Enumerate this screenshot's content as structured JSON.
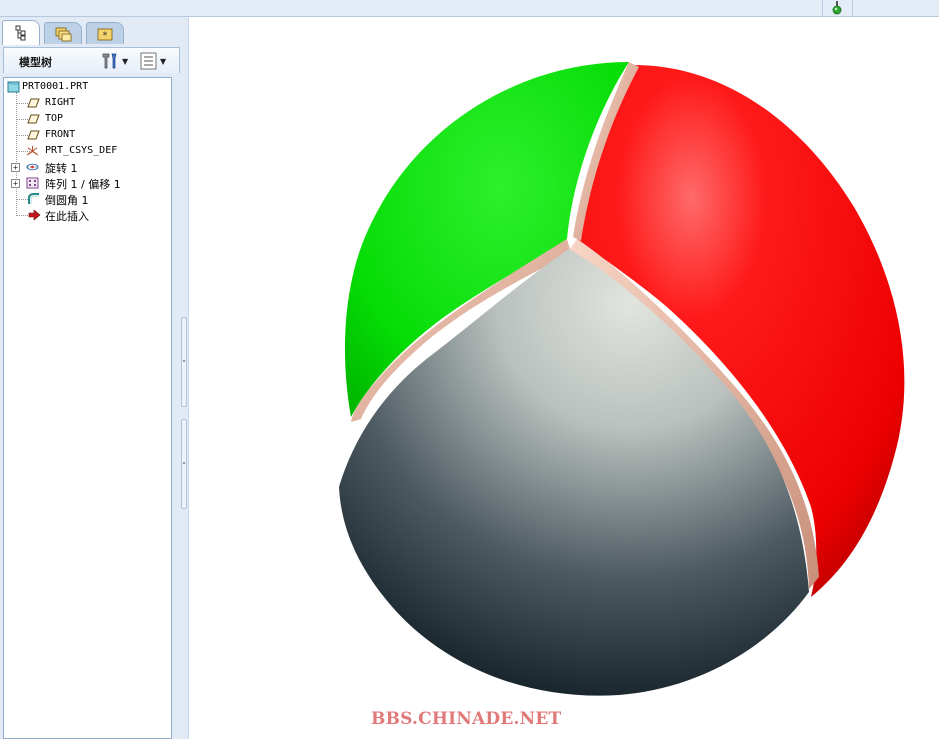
{
  "panel": {
    "tabs": [
      {
        "name": "model-tree-tab",
        "active": true
      },
      {
        "name": "folder-browser-tab",
        "active": false
      },
      {
        "name": "favorites-tab",
        "active": false
      }
    ],
    "title": "模型树"
  },
  "tree": {
    "root": "PRT0001.PRT",
    "items": [
      {
        "label": "RIGHT",
        "icon": "datum-plane-icon"
      },
      {
        "label": "TOP",
        "icon": "datum-plane-icon"
      },
      {
        "label": "FRONT",
        "icon": "datum-plane-icon"
      },
      {
        "label": "PRT_CSYS_DEF",
        "icon": "coordinate-system-icon"
      },
      {
        "label": "旋转 1",
        "icon": "revolve-icon",
        "expandable": true
      },
      {
        "label": "阵列 1 / 偏移 1",
        "icon": "pattern-icon",
        "expandable": true
      },
      {
        "label": "倒圆角 1",
        "icon": "round-icon"
      },
      {
        "label": "在此插入",
        "icon": "insert-here-arrow-icon"
      }
    ]
  },
  "viewport": {
    "watermark": "BBS.CHINADE.NET",
    "model_colors": {
      "green": "#00e000",
      "red": "#ff0000",
      "gray_light": "#dcdfd8",
      "gray_dark": "#0e1a22",
      "edge": "#f2c7b4"
    }
  }
}
